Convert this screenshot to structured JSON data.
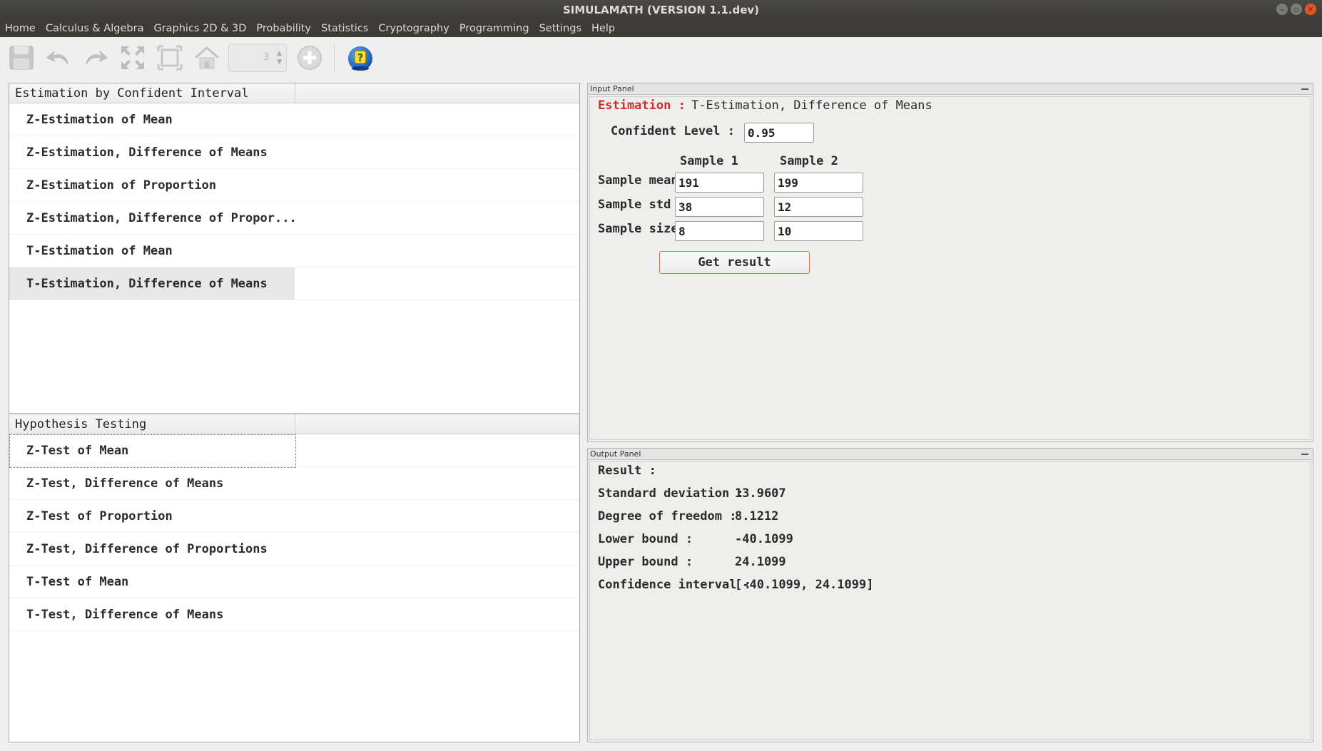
{
  "window": {
    "title": "SIMULAMATH   (VERSION 1.1.dev)"
  },
  "menu": [
    "Home",
    "Calculus & Algebra",
    "Graphics 2D & 3D",
    "Probability",
    "Statistics",
    "Cryptography",
    "Programming",
    "Settings",
    "Help"
  ],
  "toolbar": {
    "spinner_value": "3",
    "icons": [
      "save-icon",
      "undo-icon",
      "redo-icon",
      "fit-icon",
      "frame-icon",
      "home-icon",
      "plus-icon",
      "help-icon"
    ]
  },
  "estimation": {
    "header": "Estimation by Confident Interval",
    "items": [
      "Z-Estimation of Mean",
      "Z-Estimation, Difference of Means",
      "Z-Estimation of Proportion",
      "Z-Estimation, Difference of Propor...",
      "T-Estimation of Mean",
      "T-Estimation, Difference of Means"
    ],
    "selected_index": 5
  },
  "hypothesis": {
    "header": "Hypothesis Testing",
    "items": [
      "Z-Test of Mean",
      "Z-Test, Difference of Means",
      "Z-Test of Proportion",
      "Z-Test, Difference of Proportions",
      "T-Test of Mean",
      "T-Test, Difference of Means"
    ],
    "focused_index": 0
  },
  "input_panel": {
    "title": "Input Panel",
    "heading_label": "Estimation :",
    "heading_value": "T-Estimation, Difference of Means",
    "confident_level_label": "Confident Level :",
    "confident_level_value": "0.95",
    "sample1_header": "Sample 1",
    "sample2_header": "Sample 2",
    "rows": [
      {
        "label": "Sample mean",
        "s1": "191",
        "s2": "199"
      },
      {
        "label": "Sample std",
        "s1": "38",
        "s2": "12"
      },
      {
        "label": "Sample size",
        "s1": "8",
        "s2": "10"
      }
    ],
    "button_label": "Get result"
  },
  "output_panel": {
    "title": "Output Panel",
    "result_label": "Result :",
    "lines": [
      {
        "label": "Standard deviation :",
        "value": "13.9607"
      },
      {
        "label": "Degree of freedom :",
        "value": "8.1212"
      },
      {
        "label": "Lower bound :",
        "value": "-40.1099"
      },
      {
        "label": "Upper bound :",
        "value": "24.1099"
      },
      {
        "label": "Confidence interval :",
        "value": "[-40.1099, 24.1099]"
      }
    ]
  },
  "colors": {
    "accent_red": "#d42a2a",
    "titlebar": "#3c3b37",
    "button_border": "#e0744a"
  }
}
